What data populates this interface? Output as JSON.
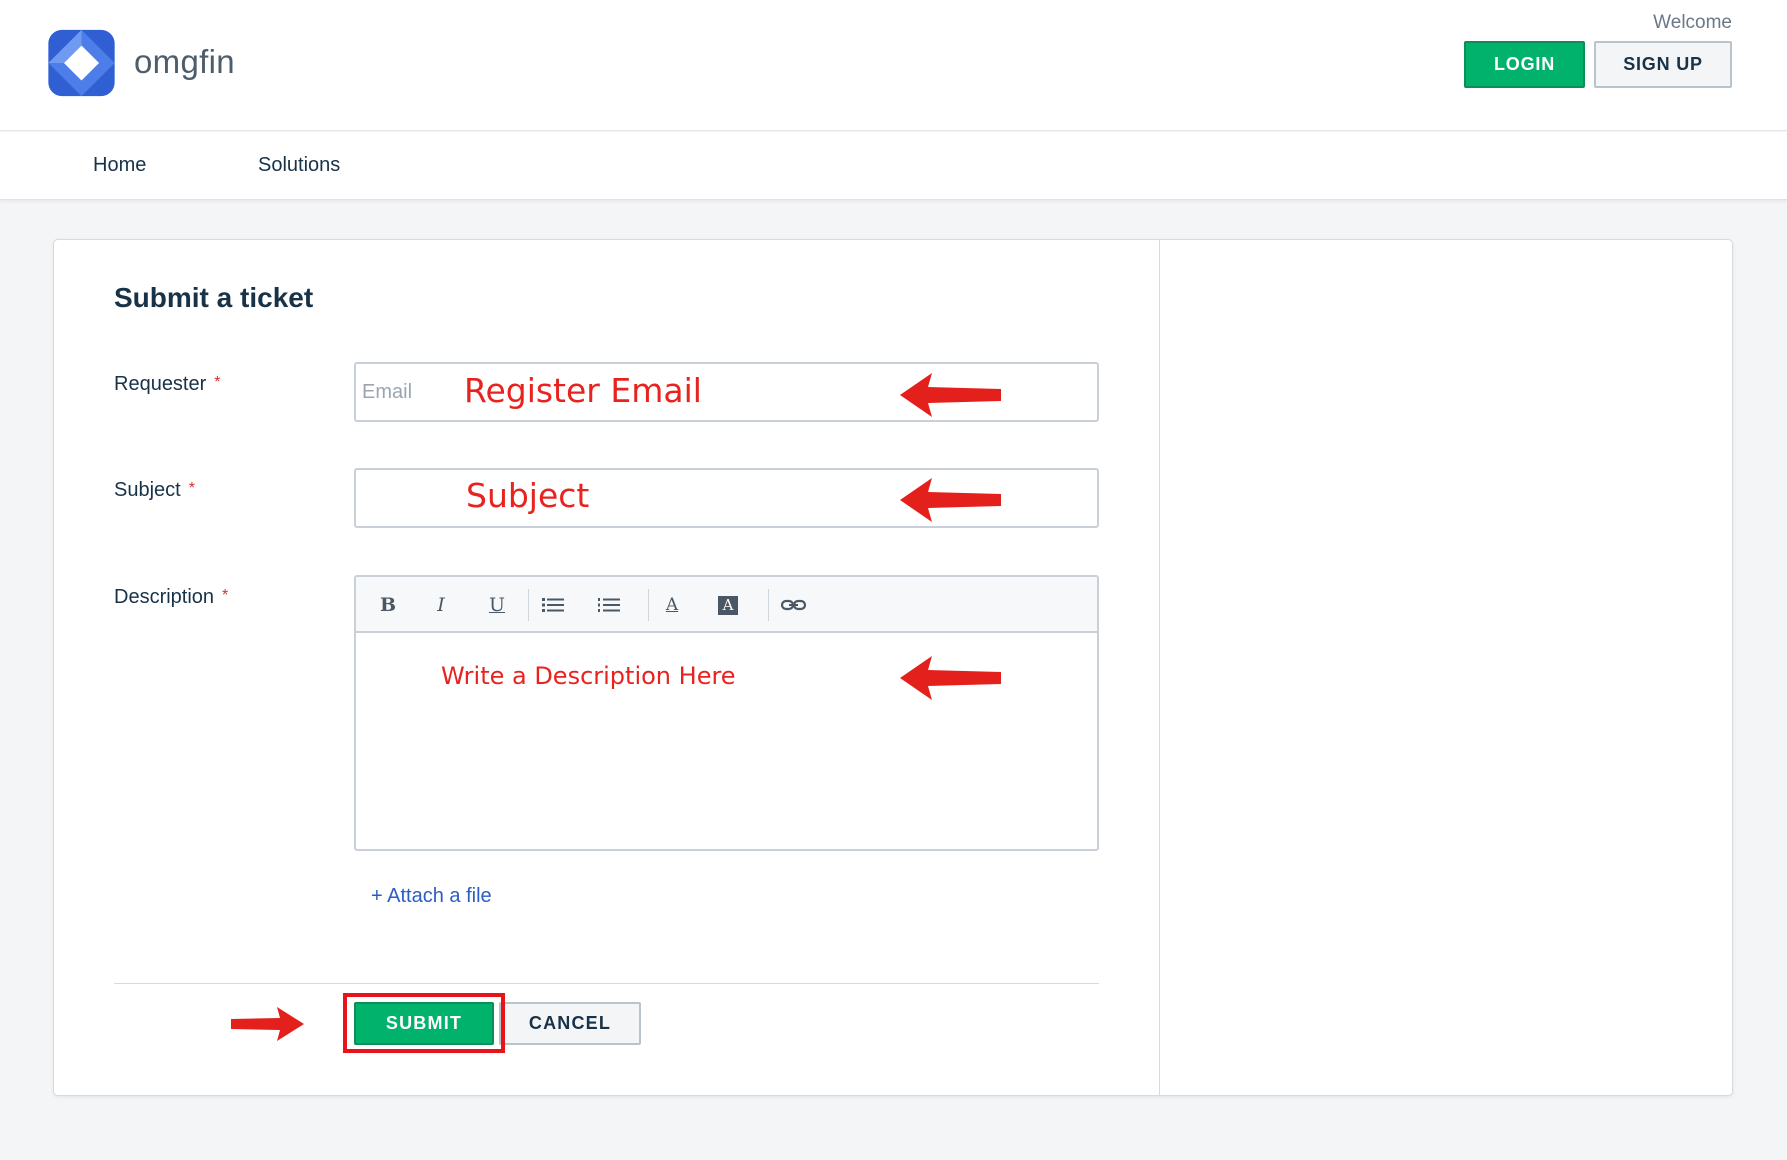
{
  "header": {
    "brand": "omgfin",
    "welcome": "Welcome",
    "login_label": "LOGIN",
    "signup_label": "SIGN UP"
  },
  "nav": {
    "items": [
      {
        "label": "Home"
      },
      {
        "label": "Solutions"
      }
    ]
  },
  "form": {
    "title": "Submit a ticket",
    "requester": {
      "label": "Requester",
      "required_mark": "*",
      "placeholder": "Email"
    },
    "subject": {
      "label": "Subject",
      "required_mark": "*",
      "placeholder": ""
    },
    "description": {
      "label": "Description",
      "required_mark": "*"
    },
    "attach_label": "+ Attach a file",
    "submit_label": "SUBMIT",
    "cancel_label": "CANCEL"
  },
  "toolbar": {
    "bold_glyph": "B",
    "italic_glyph": "I",
    "underline_glyph": "U",
    "text_color_glyph": "A",
    "bg_color_glyph": "A",
    "icons": [
      "bold-icon",
      "italic-icon",
      "underline-icon",
      "bulleted-list-icon",
      "numbered-list-icon",
      "text-color-icon",
      "background-color-icon",
      "link-icon"
    ]
  },
  "annotations": {
    "email_note": "Register Email",
    "subject_note": "Subject",
    "description_note": "Write a Description Here"
  },
  "colors": {
    "primary_green": "#00b26b",
    "annotation_red": "#e8231f",
    "link_blue": "#2c5cc5"
  }
}
